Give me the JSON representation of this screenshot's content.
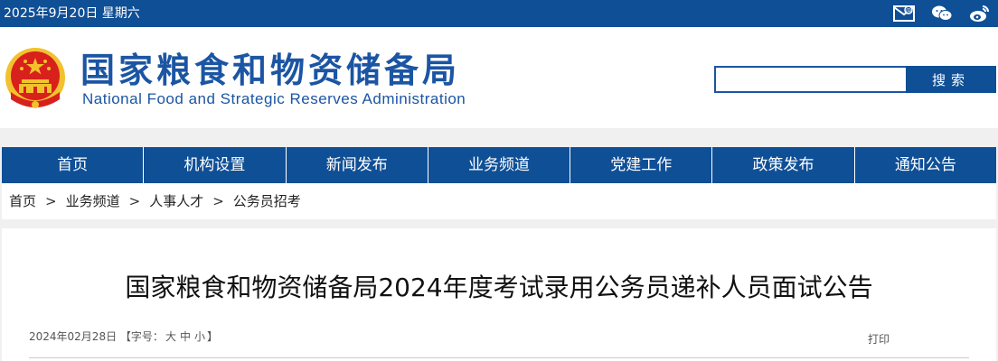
{
  "topbar": {
    "date": "2025年9月20日 星期六",
    "icons": [
      "email-icon",
      "wechat-icon",
      "weibo-icon"
    ]
  },
  "header": {
    "title_cn": "国家粮食和物资储备局",
    "title_en": "National Food and Strategic Reserves Administration",
    "search_placeholder": "",
    "search_button": "搜索"
  },
  "nav": {
    "items": [
      "首页",
      "机构设置",
      "新闻发布",
      "业务频道",
      "党建工作",
      "政策发布",
      "通知公告"
    ]
  },
  "breadcrumb": {
    "items": [
      "首页",
      "业务频道",
      "人事人才",
      "公务员招考"
    ],
    "separator": ">"
  },
  "article": {
    "title": "国家粮食和物资储备局2024年度考试录用公务员递补人员面试公告",
    "date": "2024年02月28日",
    "font_size_label": "【字号：",
    "font_sizes": [
      "大",
      "中",
      "小"
    ],
    "font_size_close": "】",
    "print": "打印"
  },
  "colors": {
    "primary": "#0f4f96",
    "title_blue": "#1b55a3",
    "emblem_red": "#d8201c",
    "emblem_gold": "#f2c12e"
  }
}
